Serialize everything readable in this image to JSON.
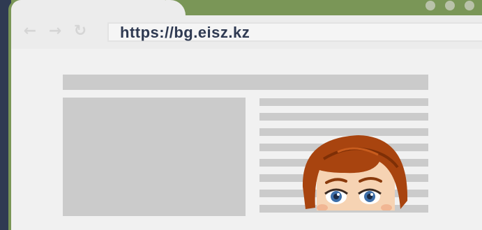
{
  "browser": {
    "url": "https://bg.eisz.kz",
    "nav_icons": [
      "back-arrow-icon",
      "forward-arrow-icon",
      "reload-icon"
    ],
    "window_controls": [
      "window-control-dot",
      "window-control-dot",
      "window-control-dot"
    ]
  },
  "colors": {
    "frame_green": "#7a9657",
    "chrome_gray": "#ececec",
    "placeholder_gray": "#cbcbcb",
    "url_text": "#2f3a52",
    "background_navy": "#2f3a52"
  },
  "illustration": {
    "character": "red-haired-person-peeking"
  }
}
